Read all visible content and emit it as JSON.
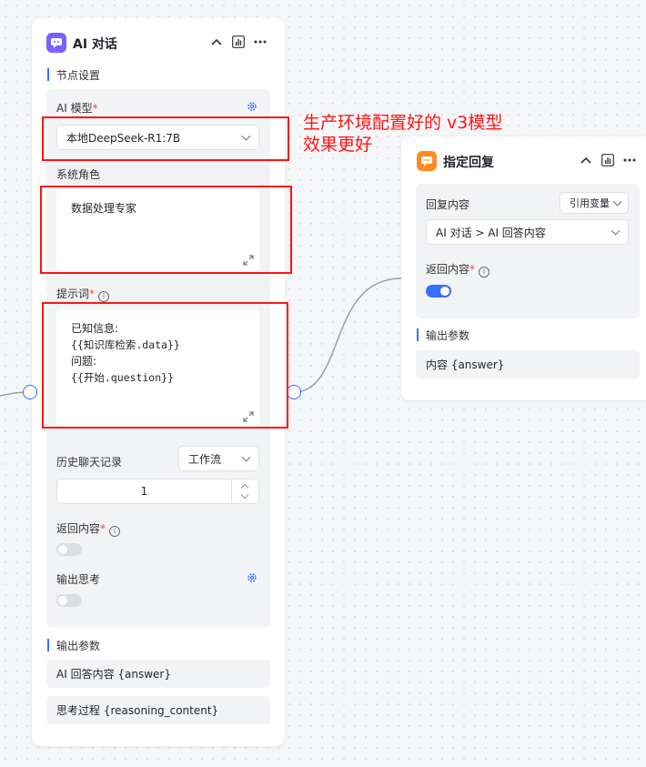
{
  "left_node": {
    "title": "AI 对话",
    "section_settings": "节点设置",
    "model_label": "AI 模型",
    "model_value": "本地DeepSeek-R1:7B",
    "role_label": "系统角色",
    "role_value": "数据处理专家",
    "prompt_label": "提示词",
    "prompt_lines": [
      "已知信息:",
      "{{知识库检索.data}}",
      "问题:",
      "{{开始.question}}"
    ],
    "history_label": "历史聊天记录",
    "history_mode": "工作流",
    "history_count": "1",
    "return_label": "返回内容",
    "return_enabled": false,
    "think_label": "输出思考",
    "think_enabled": false,
    "section_output": "输出参数",
    "outputs": [
      "AI 回答内容 {answer}",
      "思考过程 {reasoning_content}"
    ]
  },
  "right_node": {
    "title": "指定回复",
    "reply_label": "回复内容",
    "reply_mode": "引用变量",
    "reply_value": "AI 对话 > AI 回答内容",
    "return_label": "返回内容",
    "return_enabled": true,
    "section_output": "输出参数",
    "outputs": [
      "内容 {answer}"
    ]
  },
  "annotation": {
    "line1": "生产环境配置好的 v3模型",
    "line2": "效果更好"
  },
  "colors": {
    "accent": "#3370ff",
    "annotation": "#ff1414",
    "ai_icon": "#7b61ff",
    "reply_icon": "#ff8a1f"
  }
}
